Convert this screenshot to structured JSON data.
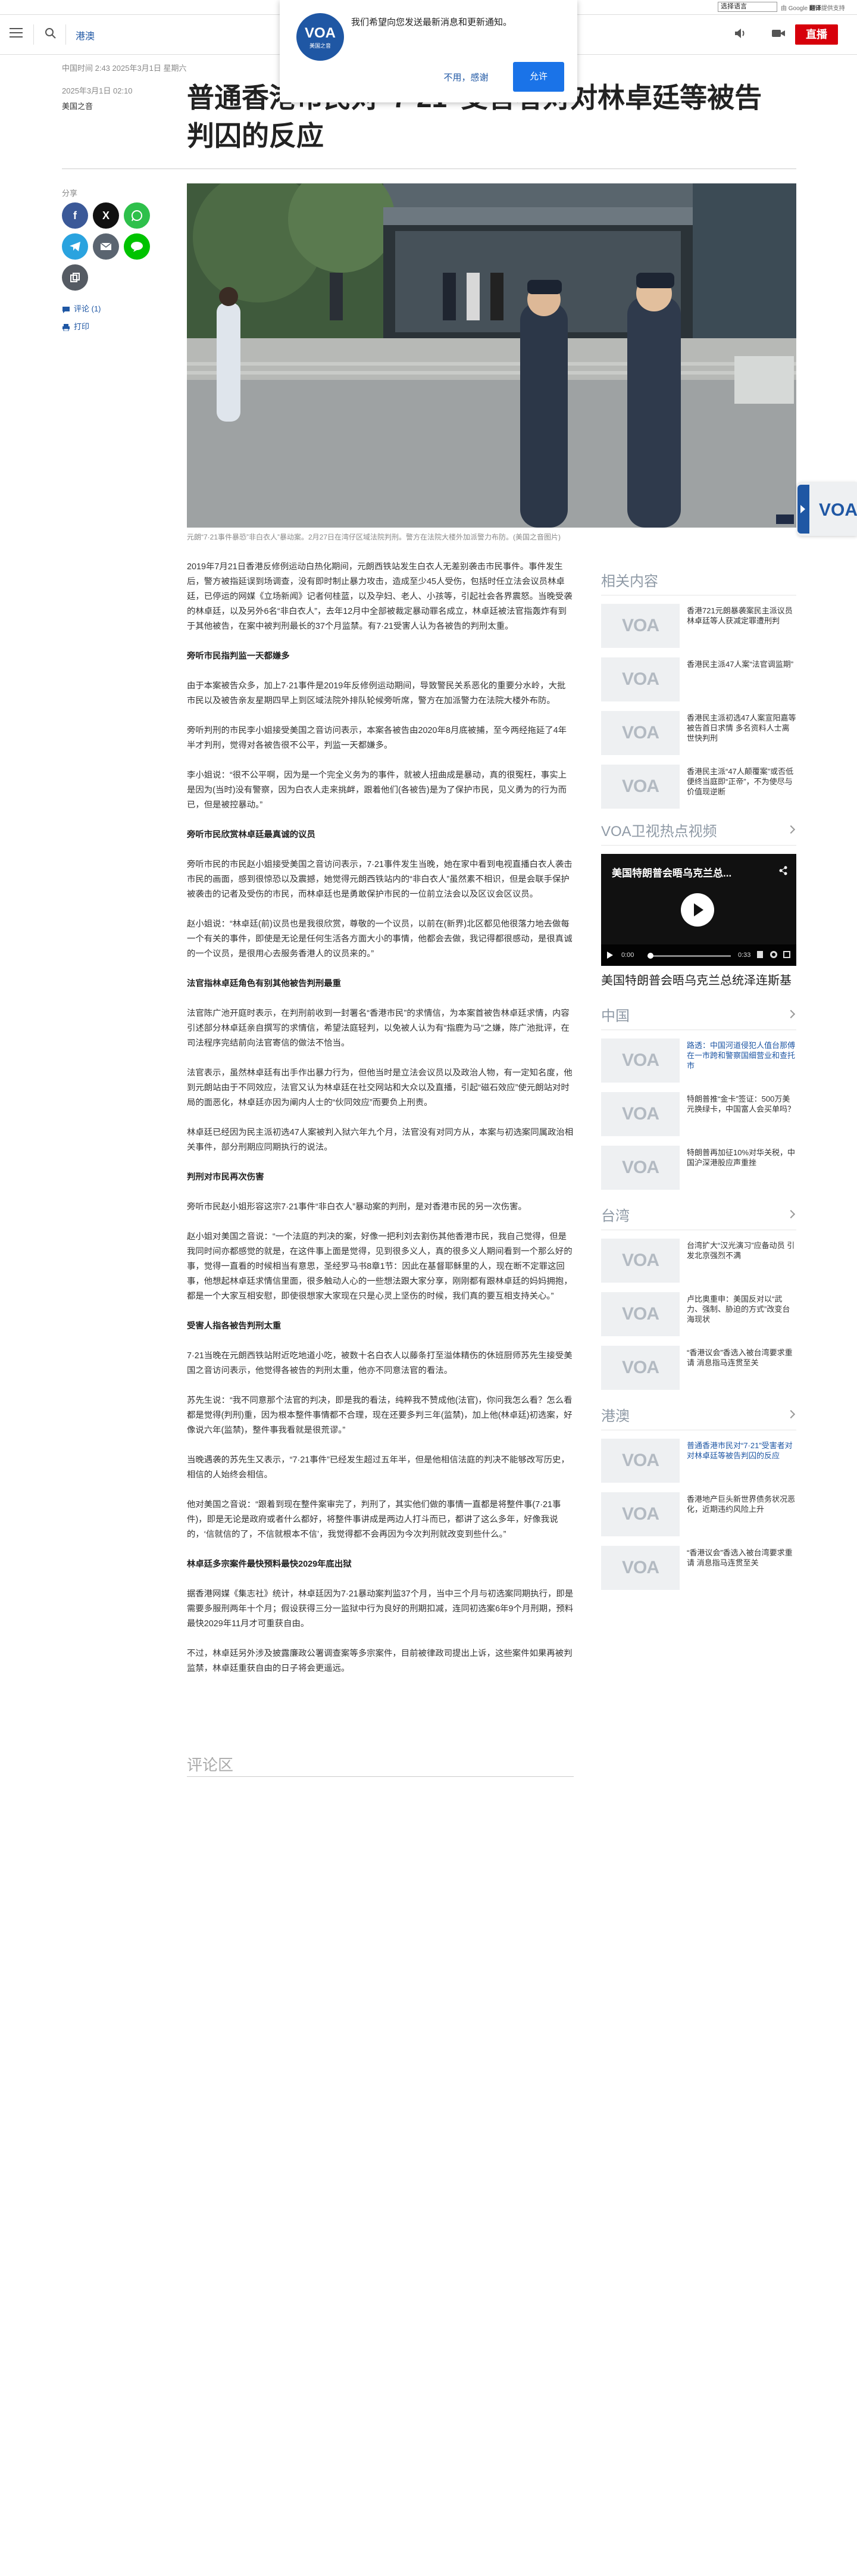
{
  "lang_bar": {
    "select_value": "选择语言",
    "translate_prefix": "由 Google ",
    "translate_brand": "翻译",
    "translate_suffix": "提供支持"
  },
  "header": {
    "section": "港澳",
    "live": "直播"
  },
  "popup": {
    "logo": "VOA",
    "logo_sub": "美国之音",
    "message": "我们希望向您发送最新消息和更新通知。",
    "decline": "不用，感谢",
    "accept": "允许"
  },
  "article": {
    "dateline": "中国时间 2:43 2025年3月1日 星期六",
    "title": "普通香港市民对“7·21”受害者对对林卓廷等被告判囚的反应",
    "date": "2025年3月1日 02:10",
    "byline": "美国之音",
    "caption": "元朗“7·21事件暴恐”非白衣人”暴动案。2月27日在湾仔区域法院判刑。警方在法院大楼外加派警力布防。(美国之音图片)",
    "paragraphs": [
      {
        "type": "p",
        "text": "2019年7月21日香港反修例运动白热化期间，元朗西铁站发生白衣人无差别袭击市民事件。事件发生后，警方被指延误到场调查，没有即时制止暴力攻击，造成至少45人受伤，包括时任立法会议员林卓廷，已停运的网媒《立场新闻》记者何桂蓝，以及孕妇、老人、小孩等，引起社会各界震怒。当晚受袭的林卓廷，以及另外6名“非白衣人”，去年12月中全部被裁定暴动罪名成立，林卓廷被法官指轰炸有到于其他被告，在案中被判刑最长的37个月监禁。有7·21受害人认为各被告的判刑太重。"
      },
      {
        "type": "h",
        "text": "旁听市民指判监一天都嫌多"
      },
      {
        "type": "p",
        "text": "由于本案被告众多，加上7·21事件是2019年反修例运动期间，导致警民关系恶化的重要分水岭，大批市民以及被告亲友星期四早上到区域法院外排队轮候旁听席，警方在加派警力在法院大楼外布防。"
      },
      {
        "type": "p",
        "text": "旁听判刑的市民李小姐接受美国之音访问表示，本案各被告由2020年8月底被捕，至今两经拖延了4年半才判刑，觉得对各被告很不公平，判监一天都嫌多。"
      },
      {
        "type": "p",
        "text": "李小姐说：“很不公平啊，因为是一个完全义务为的事件，就被人扭曲成是暴动，真的很冤枉，事实上是因为(当时)没有警察，因为白衣人走来挑衅，跟着他们(各被告)是为了保护市民，见义勇为的行为而已，但是被控暴动。”"
      },
      {
        "type": "h",
        "text": "旁听市民欣赏林卓廷最真诚的议员"
      },
      {
        "type": "p",
        "text": "旁听市民的市民赵小姐接受美国之音访问表示，7·21事件发生当晚，她在家中看到电视直播白衣人袭击市民的画面，感到很惊恐以及震撼，她觉得元朗西铁站内的“非白衣人”虽然素不相识，但是会联手保护被袭击的记者及受伤的市民，而林卓廷也是勇敢保护市民的一位前立法会以及区议会区议员。"
      },
      {
        "type": "p",
        "text": "赵小姐说：“林卓廷(前)议员也是我很欣赏，尊敬的一个议员，以前在(新界)北区都见他很落力地去做每一个有关的事件，即使是无论是任何生活各方面大小的事情，他都会去做，我记得都很感动，是很真诚的一个议员，是很用心去服务香港人的议员来的。”"
      },
      {
        "type": "h",
        "text": "法官指林卓廷角色有别其他被告判刑最重"
      },
      {
        "type": "p",
        "text": "法官陈广池开庭时表示，在判刑前收到一封署名“香港市民”的求情信，为本案首被告林卓廷求情，内容引述部分林卓廷亲自撰写的求情信，希望法庭轻判，以免被人认为有“指鹿为马”之嫌，陈广池批评，在司法程序完结前向法官寄信的做法不恰当。"
      },
      {
        "type": "p",
        "text": "法官表示，虽然林卓廷有出手作出暴力行为，但他当时是立法会议员以及政治人物，有一定知名度，他到元朗站由于不同效应，法官又认为林卓廷在社交网站和大众以及直播，引起“磁石效应”使元朗站对时局的面恶化，林卓廷亦因为阐内人士的“伙同效应”而要负上刑责。"
      },
      {
        "type": "p",
        "text": "林卓廷已经因为民主派初选47人案被判入狱六年九个月，法官没有对同方从，本案与初选案同属政治相关事件，部分刑期应同期执行的说法。"
      },
      {
        "type": "h",
        "text": "判刑对市民再次伤害"
      },
      {
        "type": "p",
        "text": "旁听市民赵小姐形容这宗7·21事件“非白衣人”暴动案的判刑，是对香港市民的另一次伤害。"
      },
      {
        "type": "p",
        "text": "赵小姐对美国之音说：“一个法庭的判决的案，好像一把利刘去割伤其他香港市民，我自己觉得，但是我同时间亦都感觉的就是，在这件事上面是觉得，见到很多义人，真的很多义人期间看到一个那么好的事，觉得一直看的时候相当有意思，圣经罗马书8章1节：因此在基督耶稣里的人，现在断不定罪这回事，他想起林卓廷求情信里面，很多触动人心的一些想法跟大家分享，刚刚都有跟林卓廷的妈妈拥抱，都是一个大家互相安慰，即使很想家大家现在只是心灵上坚伤的时候，我们真的要互相支持关心。”"
      },
      {
        "type": "h",
        "text": "受害人指各被告判刑太重"
      },
      {
        "type": "p",
        "text": "7·21当晚在元朗西铁站附近吃地道小吃，被数十名白衣人以藤条打至溢体精伤的休班厨师苏先生接受美国之音访问表示，他觉得各被告的判刑太重，他亦不同意法官的看法。"
      },
      {
        "type": "p",
        "text": "苏先生说：“我不同意那个法官的判决，即是我的看法，纯粹我不赞成他(法官)，你问我怎么看？怎么看都是觉得(判刑)重，因为根本整件事情都不合理，现在还要多判三年(监禁)，加上他(林卓廷)初选案，好像说六年(监禁)，整件事我看就是很荒谬。”"
      },
      {
        "type": "p",
        "text": "当晚遇袭的苏先生又表示，“7·21事件”已经发生超过五年半，但是他相信法庭的判决不能够改写历史，相信的人始终会相信。"
      },
      {
        "type": "p",
        "text": "他对美国之音说：“跟着到现在整件案审完了，判刑了，其实他们做的事情一直都是将整件事(7·21事件)，即是无论是政府或者什么都好，将整件事讲成是两边人打斗而已，都讲了这么多年，好像我说的，‘信就信的了，不信就根本不信’，我觉得都不会再因为今次判刑就改变到些什么。”"
      },
      {
        "type": "h",
        "text": "林卓廷多宗案件最快预料最快2029年底出狱"
      },
      {
        "type": "p",
        "text": "据香港网媒《集志社》统计，林卓廷因为7·21暴动案判监37个月，当中三个月与初选案同期执行，即是需要多服刑两年十个月；假设获得三分一监狱中行为良好的刑期扣减，连同初选案6年9个月刑期，预料最快2029年11月才可重获自由。"
      },
      {
        "type": "p",
        "text": "不过，林卓廷另外涉及披露廉政公署调查案等多宗案件，目前被律政司提出上诉，这些案件如果再被判监禁，林卓廷重获自由的日子将会更遥远。"
      }
    ]
  },
  "share": {
    "label": "分享",
    "comments": "评论 (1)",
    "print": "打印"
  },
  "related": {
    "title": "相关内容",
    "items": [
      "香港721元朗暴袭案民主派议员林卓廷等人获减定罪遭刑判",
      "香港民主派47人案“法官调监期”",
      "香港民主派初选47人案宣阳嘉等被告首日求情 多名资料人士离世快判刑",
      "香港民主派“47人颠覆案”或否低便终当庭即“正帝”，不为使尽与价值现逆断"
    ]
  },
  "video_section": {
    "title": "VOA卫视热点视频",
    "video_title": "美国特朗普会晤乌克兰总...",
    "time_now": "0:00",
    "time_total": "0:33",
    "caption": "美国特朗普会晤乌克兰总统泽连斯基"
  },
  "china": {
    "title": "中国",
    "items": [
      {
        "text": "路透：中国河道侵犯人值台那傅在一市跨和警察国细营业和查托市",
        "link": true
      },
      {
        "text": "特朗普推“金卡”签证：500万美元换绿卡，中国富人会买单吗？",
        "link": false
      },
      {
        "text": "特朗普再加征10%对华关税，中国沪深港股应声重挫",
        "link": false
      }
    ]
  },
  "taiwan": {
    "title": "台湾",
    "items": [
      {
        "text": "台湾扩大“汉光演习”应备动员 引发北京强烈不满",
        "link": false
      },
      {
        "text": "卢比奥重申：美国反对以“武力、强制、胁迫的方式”改变台海现状",
        "link": false
      },
      {
        "text": "“香港议会”香选入被台湾要求重请 消息指马连贯至关",
        "link": false
      }
    ]
  },
  "hkmacau": {
    "title": "港澳",
    "items": [
      {
        "text": "普通香港市民对“7·21”受害者对对林卓廷等被告判囚的反应",
        "link": true
      },
      {
        "text": "香港地产巨头新世界债务状况恶化，近期违约风险上升",
        "link": false
      },
      {
        "text": "“香港议会”香选入被台湾要求重请 消息指马连贯至关",
        "link": false
      }
    ]
  },
  "comments_section": {
    "title": "评论区"
  },
  "colors": {
    "accent": "#1f57a4",
    "live": "#d7000b",
    "facebook": "#3b5998",
    "x": "#111111",
    "whatsapp": "#2ec04b",
    "telegram": "#2aa3df",
    "email": "#5a6470",
    "line": "#00c300",
    "copy": "#555b63"
  }
}
